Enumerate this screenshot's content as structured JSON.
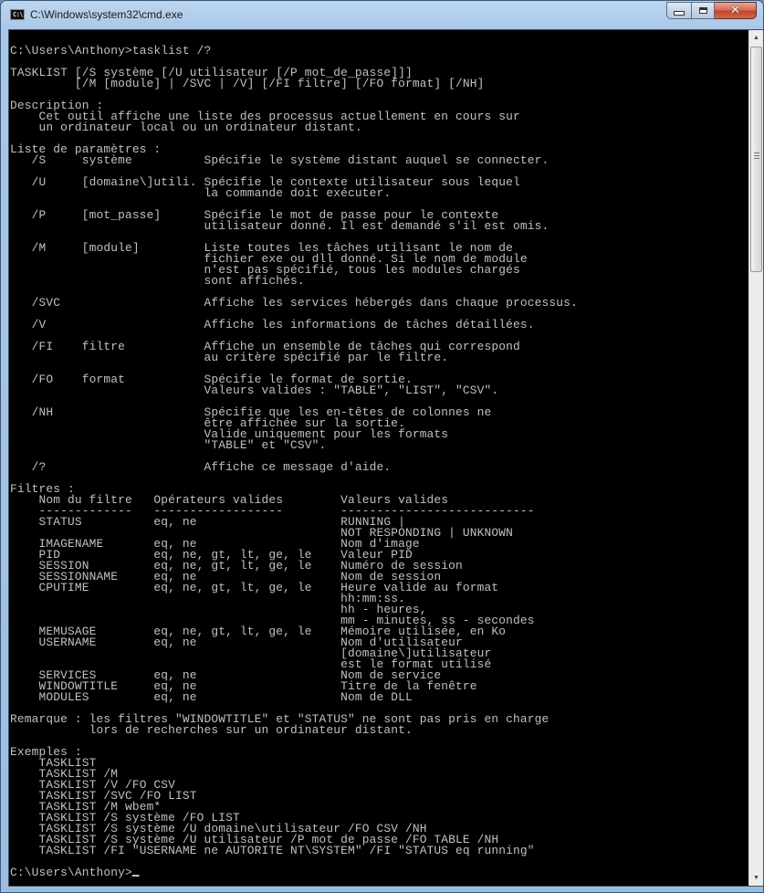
{
  "window": {
    "title": "C:\\Windows\\system32\\cmd.exe",
    "icon": "cmd-icon",
    "icon_text": "C:\\.",
    "controls": {
      "minimize": "minimize-icon",
      "maximize": "maximize-icon",
      "close": "close-icon",
      "close_glyph": "✕"
    }
  },
  "colors": {
    "console_bg": "#000000",
    "console_fg": "#c0c0c0",
    "close_button": "#c7432a"
  },
  "scrollbar": {
    "up_glyph": "▲",
    "down_glyph": "▼",
    "position": "top"
  },
  "console": {
    "lines": [
      "",
      "C:\\Users\\Anthony>tasklist /?",
      "",
      "TASKLIST [/S système [/U utilisateur [/P mot_de_passe]]]",
      "         [/M [module] | /SVC | /V] [/FI filtre] [/FO format] [/NH]",
      "",
      "Description :",
      "    Cet outil affiche une liste des processus actuellement en cours sur",
      "    un ordinateur local ou un ordinateur distant.",
      "",
      "Liste de paramètres :",
      "   /S     système          Spécifie le système distant auquel se connecter.",
      "",
      "   /U     [domaine\\]utili. Spécifie le contexte utilisateur sous lequel",
      "                           la commande doit exécuter.",
      "",
      "   /P     [mot_passe]      Spécifie le mot de passe pour le contexte",
      "                           utilisateur donné. Il est demandé s'il est omis.",
      "",
      "   /M     [module]         Liste toutes les tâches utilisant le nom de",
      "                           fichier exe ou dll donné. Si le nom de module",
      "                           n'est pas spécifié, tous les modules chargés",
      "                           sont affichés.",
      "",
      "   /SVC                    Affiche les services hébergés dans chaque processus.",
      "",
      "   /V                      Affiche les informations de tâches détaillées.",
      "",
      "   /FI    filtre           Affiche un ensemble de tâches qui correspond",
      "                           au critère spécifié par le filtre.",
      "",
      "   /FO    format           Spécifie le format de sortie.",
      "                           Valeurs valides : \"TABLE\", \"LIST\", \"CSV\".",
      "",
      "   /NH                     Spécifie que les en-têtes de colonnes ne",
      "                           être affichée sur la sortie.",
      "                           Valide uniquement pour les formats",
      "                           \"TABLE\" et \"CSV\".",
      "",
      "   /?                      Affiche ce message d'aide.",
      "",
      "Filtres :",
      "    Nom du filtre   Opérateurs valides        Valeurs valides",
      "    -------------   ------------------        ---------------------------",
      "    STATUS          eq, ne                    RUNNING |",
      "                                              NOT RESPONDING | UNKNOWN",
      "    IMAGENAME       eq, ne                    Nom d'image",
      "    PID             eq, ne, gt, lt, ge, le    Valeur PID",
      "    SESSION         eq, ne, gt, lt, ge, le    Numéro de session",
      "    SESSIONNAME     eq, ne                    Nom de session",
      "    CPUTIME         eq, ne, gt, lt, ge, le    Heure valide au format",
      "                                              hh:mm:ss.",
      "                                              hh - heures,",
      "                                              mm - minutes, ss - secondes",
      "    MEMUSAGE        eq, ne, gt, lt, ge, le    Mémoire utilisée, en Ko",
      "    USERNAME        eq, ne                    Nom d'utilisateur",
      "                                              [domaine\\]utilisateur",
      "                                              est le format utilisé",
      "    SERVICES        eq, ne                    Nom de service",
      "    WINDOWTITLE     eq, ne                    Titre de la fenêtre",
      "    MODULES         eq, ne                    Nom de DLL",
      "",
      "Remarque : les filtres \"WINDOWTITLE\" et \"STATUS\" ne sont pas pris en charge",
      "           lors de recherches sur un ordinateur distant.",
      "",
      "Exemples :",
      "    TASKLIST",
      "    TASKLIST /M",
      "    TASKLIST /V /FO CSV",
      "    TASKLIST /SVC /FO LIST",
      "    TASKLIST /M wbem*",
      "    TASKLIST /S système /FO LIST",
      "    TASKLIST /S système /U domaine\\utilisateur /FO CSV /NH",
      "    TASKLIST /S système /U utilisateur /P mot de passe /FO TABLE /NH",
      "    TASKLIST /FI \"USERNAME ne AUTORITE NT\\SYSTEM\" /FI \"STATUS eq running\"",
      ""
    ],
    "prompt": "C:\\Users\\Anthony>"
  }
}
